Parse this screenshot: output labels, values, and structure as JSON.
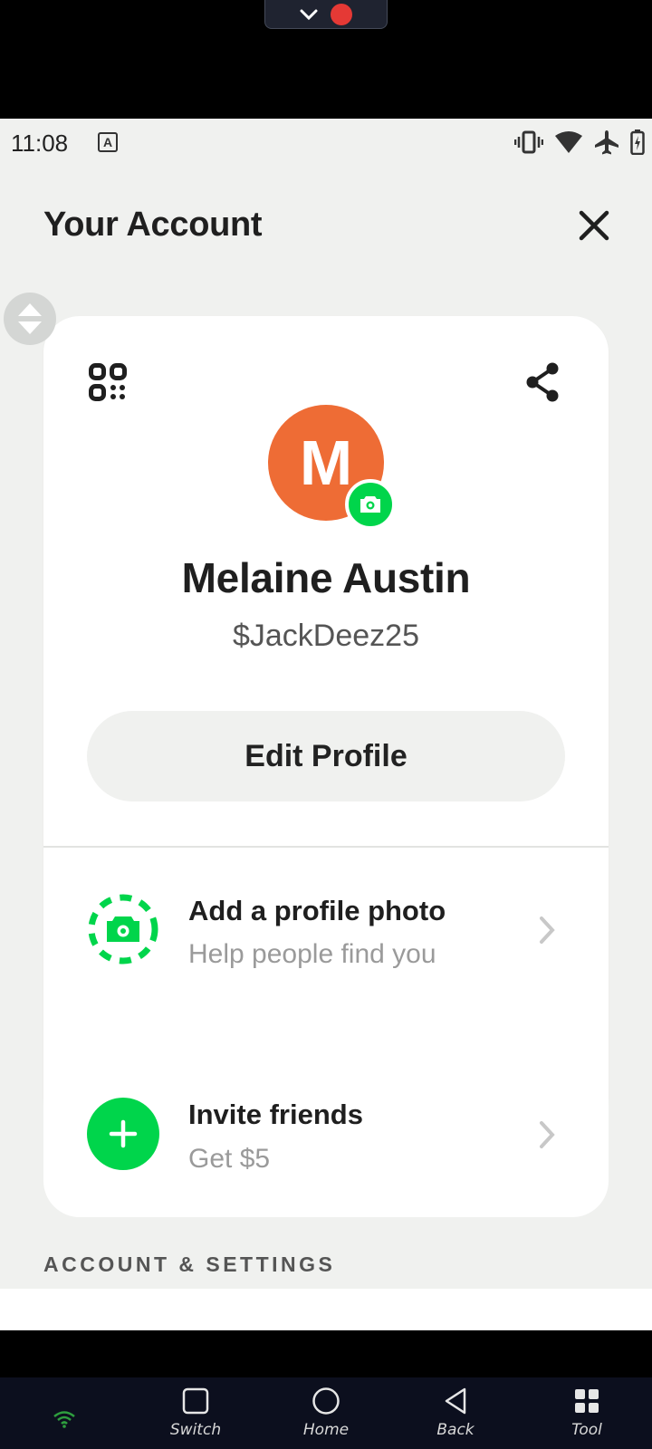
{
  "status_bar": {
    "time": "11:08",
    "keyboard_indicator": "A"
  },
  "header": {
    "title": "Your Account"
  },
  "profile": {
    "avatar_initial": "M",
    "name": "Melaine Austin",
    "cashtag": "$JackDeez25",
    "edit_button_label": "Edit Profile"
  },
  "rows": {
    "profile_photo": {
      "title": "Add a profile photo",
      "subtitle": "Help people find you"
    },
    "invite": {
      "title": "Invite friends",
      "subtitle": "Get $5"
    }
  },
  "section": {
    "label": "ACCOUNT & SETTINGS"
  },
  "navbar": {
    "switch": "Switch",
    "home": "Home",
    "back": "Back",
    "tool": "Tool"
  },
  "colors": {
    "brand_green": "#00d54b",
    "avatar_orange": "#ee6c35",
    "background": "#f0f1ef"
  },
  "icons": [
    "qr-code-icon",
    "share-icon",
    "camera-icon",
    "close-icon",
    "chevron-right-icon",
    "plus-icon",
    "wifi-icon",
    "vibrate-icon",
    "airplane-icon",
    "battery-icon"
  ]
}
